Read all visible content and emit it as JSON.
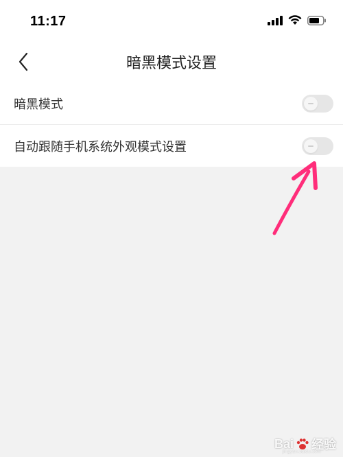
{
  "status_bar": {
    "time": "11:17",
    "icons": [
      "cellular-signal-icon",
      "wifi-icon",
      "battery-icon"
    ]
  },
  "nav": {
    "title": "暗黑模式设置",
    "back_icon": "chevron-left-icon"
  },
  "settings": [
    {
      "label": "暗黑模式",
      "enabled": false
    },
    {
      "label": "自动跟随手机系统外观模式设置",
      "enabled": false
    }
  ],
  "annotation": {
    "color": "#ff2d7a"
  },
  "watermark": {
    "text_prefix": "Bai",
    "text_suffix": "经验",
    "sub": "jingyan.baidu.com"
  },
  "colors": {
    "page_bg": "#f2f2f2",
    "surface": "#ffffff",
    "toggle_off": "#e6e6e6",
    "text_primary": "#222222"
  }
}
